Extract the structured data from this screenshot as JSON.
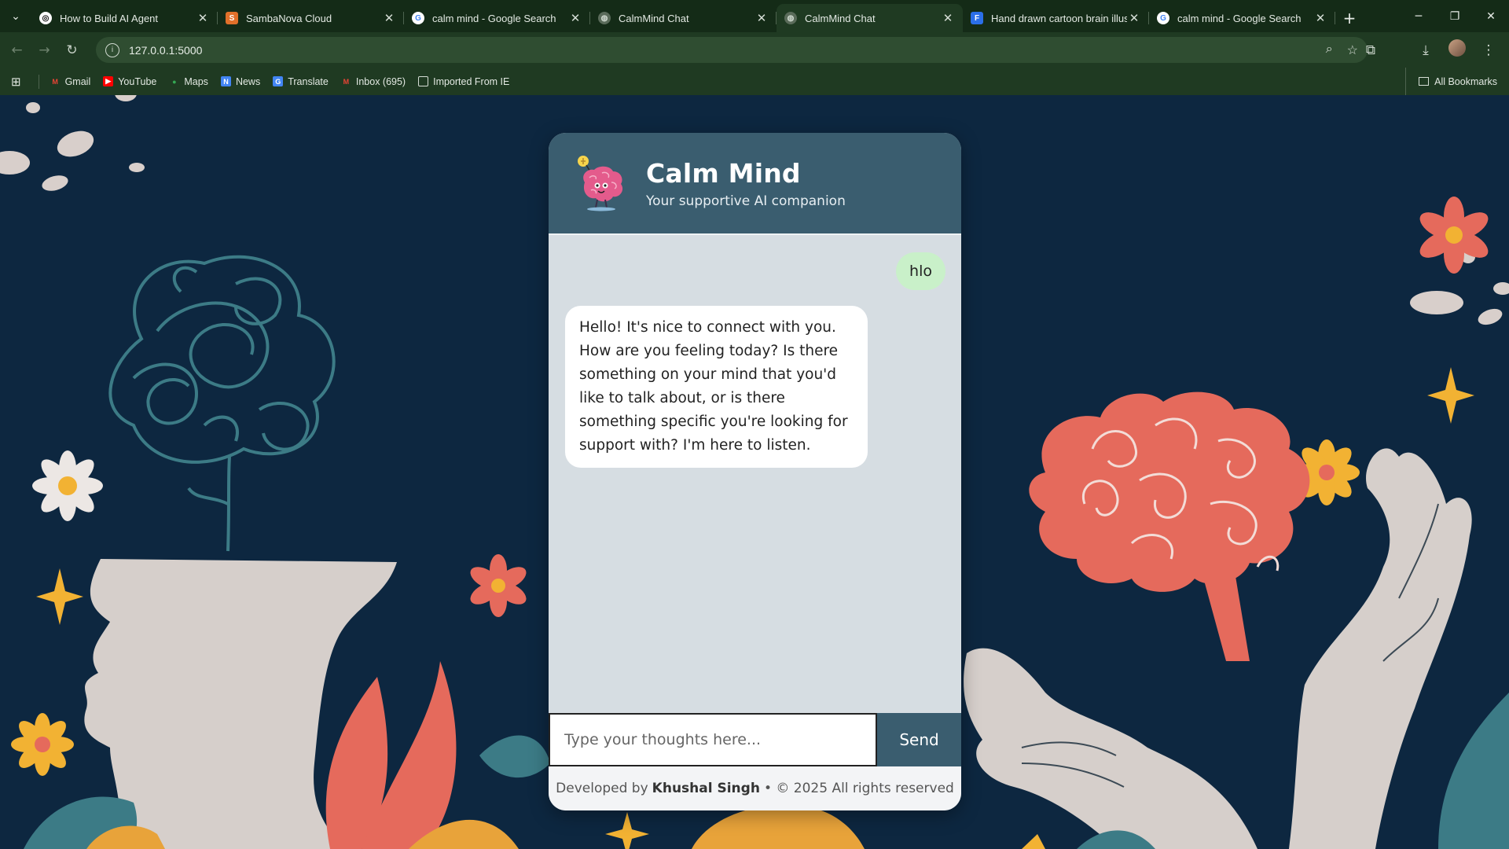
{
  "browser": {
    "tabs": [
      {
        "title": "How to Build AI Agent",
        "icon": "openai-icon",
        "color": "#ffffff"
      },
      {
        "title": "SambaNova Cloud",
        "icon": "sambanova-icon",
        "color": "#e0702a"
      },
      {
        "title": "calm mind - Google Search",
        "icon": "google-icon",
        "color": "#4285f4"
      },
      {
        "title": "CalmMind Chat",
        "icon": "globe-icon",
        "color": "#8a9a8a"
      },
      {
        "title": "CalmMind Chat",
        "icon": "globe-icon",
        "color": "#8a9a8a",
        "active": true
      },
      {
        "title": "Hand drawn cartoon brain illus",
        "icon": "freepik-icon",
        "color": "#2b6fe8"
      },
      {
        "title": "calm mind - Google Search",
        "icon": "google-icon",
        "color": "#4285f4"
      }
    ],
    "url": "127.0.0.1:5000",
    "bookmarks": [
      {
        "label": "Gmail",
        "icon": "gmail-icon",
        "color": "#ea4335"
      },
      {
        "label": "YouTube",
        "icon": "youtube-icon",
        "color": "#ff0000"
      },
      {
        "label": "Maps",
        "icon": "maps-icon",
        "color": "#34a853"
      },
      {
        "label": "News",
        "icon": "news-icon",
        "color": "#4285f4"
      },
      {
        "label": "Translate",
        "icon": "translate-icon",
        "color": "#4285f4"
      },
      {
        "label": "Inbox (695)",
        "icon": "gmail-icon",
        "color": "#ea4335"
      },
      {
        "label": "Imported From IE",
        "icon": "folder-icon",
        "color": "#d5ddd5"
      }
    ],
    "all_bookmarks": "All Bookmarks"
  },
  "app": {
    "title": "Calm Mind",
    "subtitle": "Your supportive AI companion",
    "messages": {
      "user": "hlo",
      "bot": "Hello! It's nice to connect with you. How are you feeling today? Is there something on your mind that you'd like to talk about, or is there something specific you're looking for support with? I'm here to listen."
    },
    "input_placeholder": "Type your thoughts here...",
    "send_label": "Send",
    "footer": {
      "prefix": "Developed by",
      "author": "Khushal Singh",
      "suffix": "• © 2025 All rights reserved"
    },
    "colors": {
      "header": "#3a5d6f",
      "background": "#0d2740",
      "user_bubble": "#c9f0c9",
      "accent_coral": "#e56a5c",
      "accent_yellow": "#f2b233"
    }
  }
}
